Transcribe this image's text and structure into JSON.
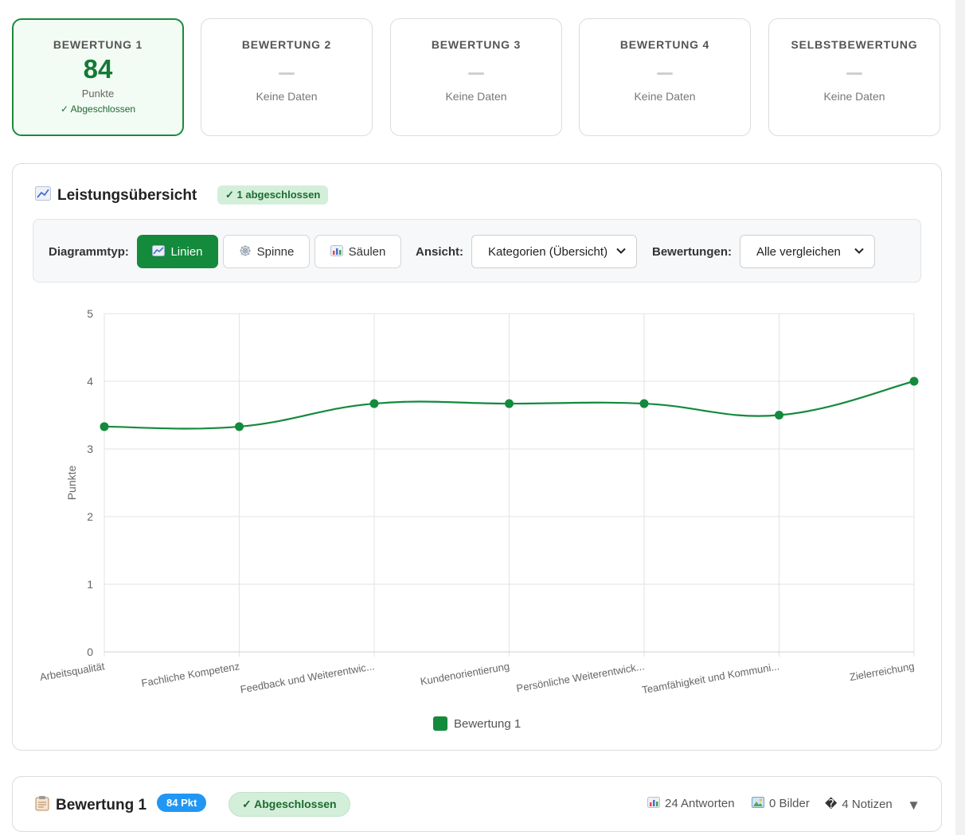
{
  "cards": [
    {
      "title": "BEWERTUNG 1",
      "score": "84",
      "unit": "Punkte",
      "status": "✓ Abgeschlossen"
    },
    {
      "title": "BEWERTUNG 2",
      "nodata": "Keine Daten"
    },
    {
      "title": "BEWERTUNG 3",
      "nodata": "Keine Daten"
    },
    {
      "title": "BEWERTUNG 4",
      "nodata": "Keine Daten"
    },
    {
      "title": "SELBSTBEWERTUNG",
      "nodata": "Keine Daten"
    }
  ],
  "overview": {
    "title": "Leistungsübersicht",
    "badge": "✓ 1 abgeschlossen",
    "chart_type_label": "Diagrammtyp:",
    "chart_types": [
      "Linien",
      "Spinne",
      "Säulen"
    ],
    "view_label": "Ansicht:",
    "view_value": "Kategorien (Übersicht)",
    "compare_label": "Bewertungen:",
    "compare_value": "Alle vergleichen"
  },
  "chart_data": {
    "type": "line",
    "categories": [
      "Arbeitsqualität",
      "Fachliche Kompetenz",
      "Feedback und Weiterentwic...",
      "Kundenorientierung",
      "Persönliche Weiterentwick...",
      "Teamfähigkeit und Kommuni...",
      "Zielerreichung"
    ],
    "series": [
      {
        "name": "Bewertung 1",
        "values": [
          3.33,
          3.33,
          3.67,
          3.67,
          3.67,
          3.5,
          4.0
        ],
        "color": "#138a3c"
      }
    ],
    "ylabel": "Punkte",
    "ylim": [
      0,
      5
    ],
    "yticks": [
      "0",
      "1",
      "2",
      "3",
      "4",
      "5"
    ],
    "grid": true,
    "legend": "bottom"
  },
  "entry": {
    "title": "Bewertung 1",
    "points_badge": "84 Pkt",
    "status_badge": "✓ Abgeschlossen",
    "answers": "24 Antworten",
    "images": "0 Bilder",
    "notes": "4 Notizen",
    "notes_glyph": "�"
  }
}
